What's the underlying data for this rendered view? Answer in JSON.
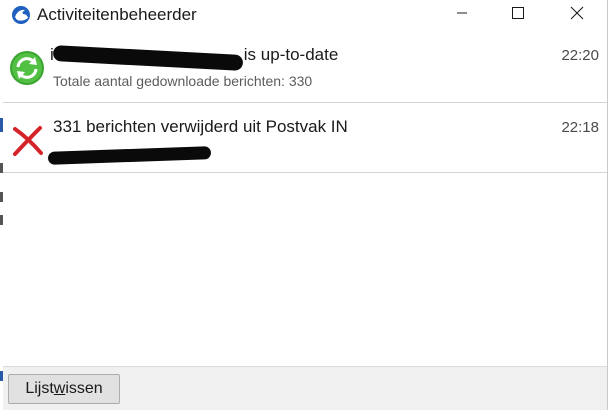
{
  "window": {
    "title": "Activiteitenbeheerder",
    "app_icon": "thunderbird-icon",
    "controls": {
      "minimize": "minimize-icon",
      "maximize": "maximize-icon",
      "close": "close-icon"
    }
  },
  "activities": [
    {
      "icon": "sync-complete-icon",
      "title_prefix": "i",
      "title_suffix": "is up-to-date",
      "subtitle": "Totale aantal gedownloade berichten: 330",
      "time": "22:20"
    },
    {
      "icon": "error-x-icon",
      "title": "331 berichten verwijderd uit Postvak IN",
      "time": "22:18"
    }
  ],
  "footer": {
    "clear_before": "Lijst ",
    "clear_accel": "w",
    "clear_after": "issen"
  },
  "colors": {
    "accent_blue": "#1f5fbf",
    "sync_green": "#3aa531",
    "error_red": "#d4242a"
  }
}
